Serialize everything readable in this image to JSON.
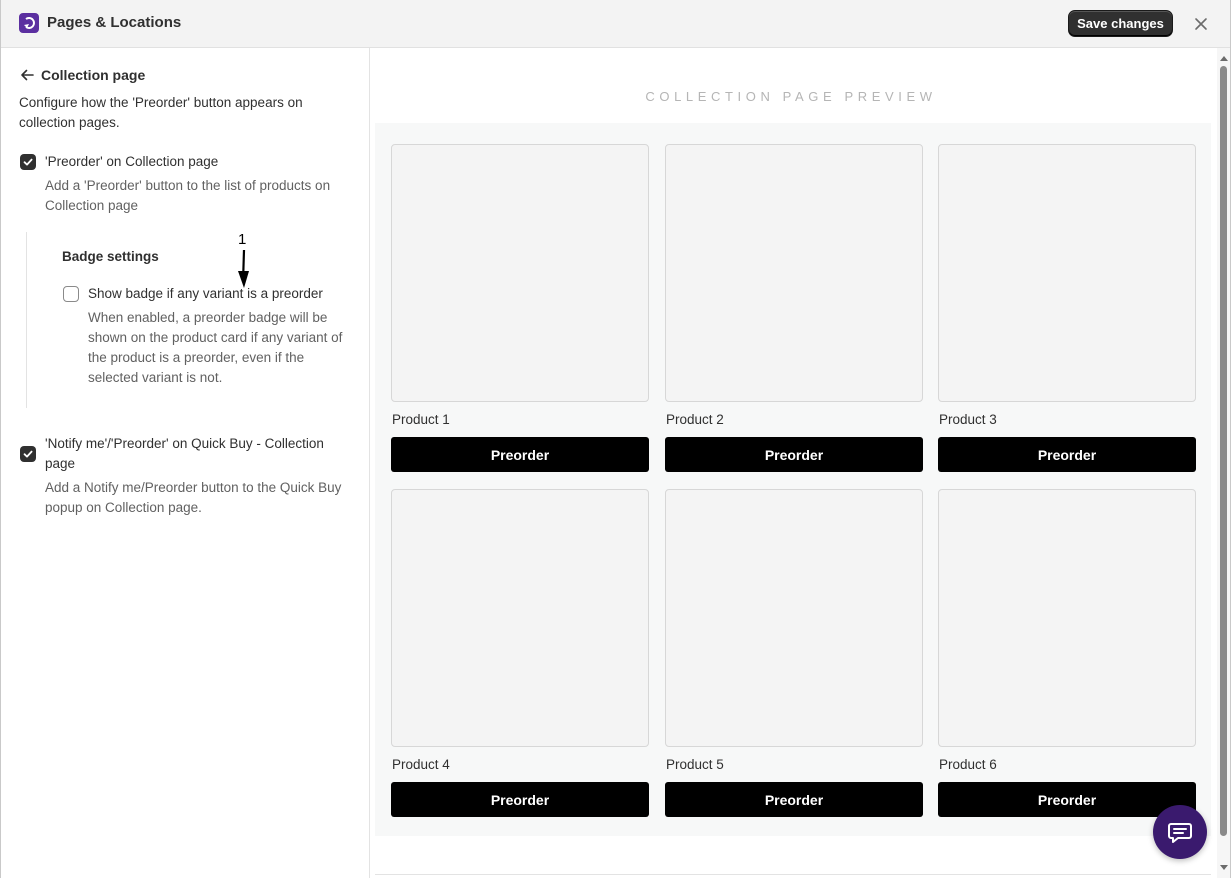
{
  "window": {
    "title": "Pages & Locations",
    "save_label": "Save changes",
    "accent_color": "#5b2fa0"
  },
  "settings": {
    "back_label": "Collection page",
    "intro": "Configure how the 'Preorder' button appears on collection pages.",
    "options": [
      {
        "label": "'Preorder' on Collection page",
        "help": "Add a 'Preorder' button to the list of products on Collection page",
        "checked": true
      },
      {
        "label": "'Notify me'/'Preorder' on Quick Buy - Collection page",
        "help": "Add a Notify me/Preorder button to the Quick Buy popup on Collection page.",
        "checked": true
      }
    ],
    "badge": {
      "title": "Badge settings",
      "option_label": "Show badge if any variant is a preorder",
      "option_help": "When enabled, a preorder badge will be shown on the product card if any variant of the product is a preorder, even if the selected variant is not.",
      "checked": false
    }
  },
  "annotation": {
    "number": "1"
  },
  "preview": {
    "title": "COLLECTION PAGE PREVIEW",
    "products": [
      {
        "name": "Product 1",
        "button": "Preorder"
      },
      {
        "name": "Product 2",
        "button": "Preorder"
      },
      {
        "name": "Product 3",
        "button": "Preorder"
      },
      {
        "name": "Product 4",
        "button": "Preorder"
      },
      {
        "name": "Product 5",
        "button": "Preorder"
      },
      {
        "name": "Product 6",
        "button": "Preorder"
      }
    ]
  },
  "icons": {
    "logo": "app-logo-icon",
    "close": "close-icon",
    "back": "arrow-left-icon",
    "chat": "chat-icon"
  }
}
